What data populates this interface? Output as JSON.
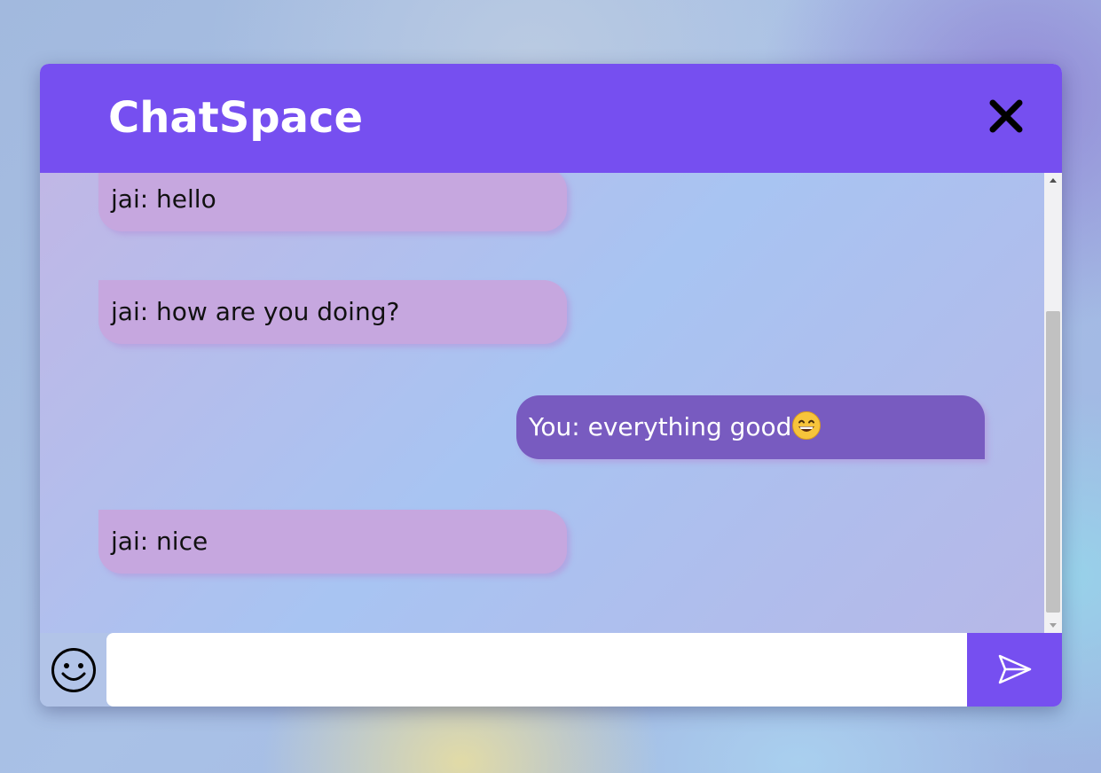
{
  "header": {
    "title": "ChatSpace",
    "close_icon": "close-icon"
  },
  "messages": [
    {
      "sender": "jai",
      "text": "jai: hello",
      "direction": "incoming"
    },
    {
      "sender": "jai",
      "text": "jai: how are you doing?",
      "direction": "incoming"
    },
    {
      "sender": "You",
      "text": "You: everything good",
      "emoji": "grinning-face-emoji",
      "direction": "outgoing"
    },
    {
      "sender": "jai",
      "text": "jai: nice",
      "direction": "incoming"
    }
  ],
  "composer": {
    "input_value": "",
    "input_placeholder": "",
    "emoji_icon": "smiley-icon",
    "send_icon": "send-icon"
  },
  "colors": {
    "accent": "#764ff0",
    "incoming_bubble": "#c6a7df",
    "outgoing_bubble": "#785bc0",
    "outgoing_text": "#ffffff",
    "incoming_text": "#111111"
  }
}
